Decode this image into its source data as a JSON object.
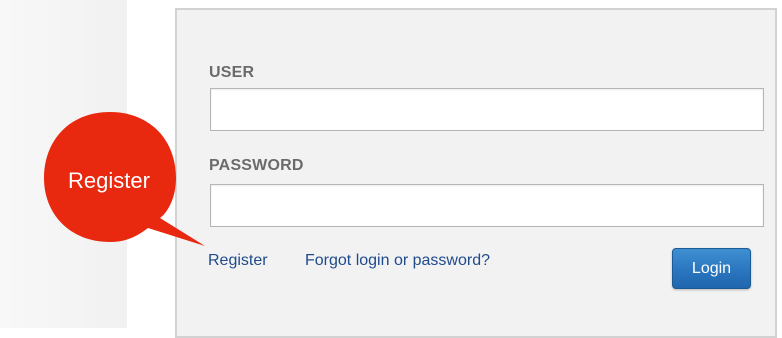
{
  "form": {
    "user_label": "USER",
    "user_value": "",
    "password_label": "PASSWORD",
    "password_value": "",
    "register_link": "Register",
    "forgot_link": "Forgot login or password?",
    "login_button": "Login"
  },
  "callout": {
    "text": "Register",
    "color": "#e8280f"
  },
  "colors": {
    "panel_bg": "#f2f2f2",
    "link": "#1f4a8c",
    "button": "#2a76bf"
  }
}
